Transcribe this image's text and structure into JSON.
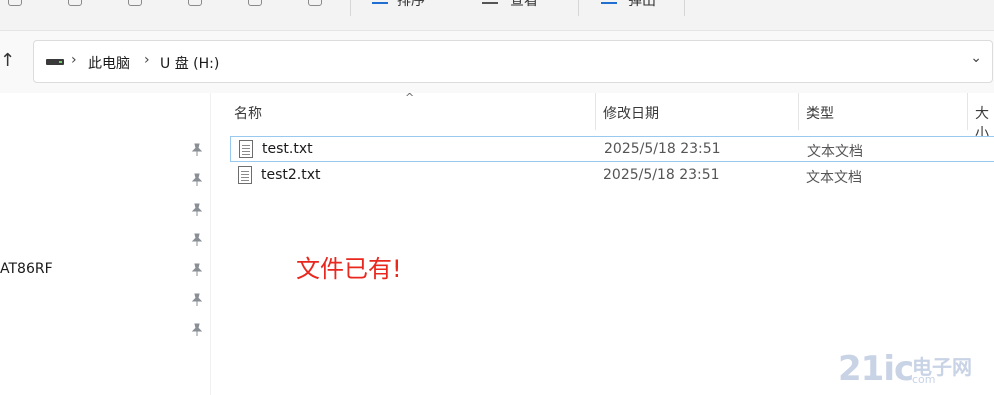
{
  "toolbar": {
    "sort_label": "排序",
    "view_label": "查看",
    "eject_label": "弹出"
  },
  "address": {
    "crumbs": [
      "此电脑",
      "U 盘 (H:)"
    ]
  },
  "nav": {
    "partial_item": "AT86RF"
  },
  "columns": {
    "name": "名称",
    "date": "修改日期",
    "type": "类型",
    "size": "大小"
  },
  "files": [
    {
      "name": "test.txt",
      "date": "2025/5/18 23:51",
      "type": "文本文档"
    },
    {
      "name": "test2.txt",
      "date": "2025/5/18 23:51",
      "type": "文本文档"
    }
  ],
  "annotation": "文件已有!",
  "watermark": {
    "brand": "21ic",
    "cn": "电子网",
    "domain": "com"
  },
  "colors": {
    "annotation": "#e8281f",
    "selection_border": "#99c9ef",
    "accent": "#1f6fd1"
  }
}
